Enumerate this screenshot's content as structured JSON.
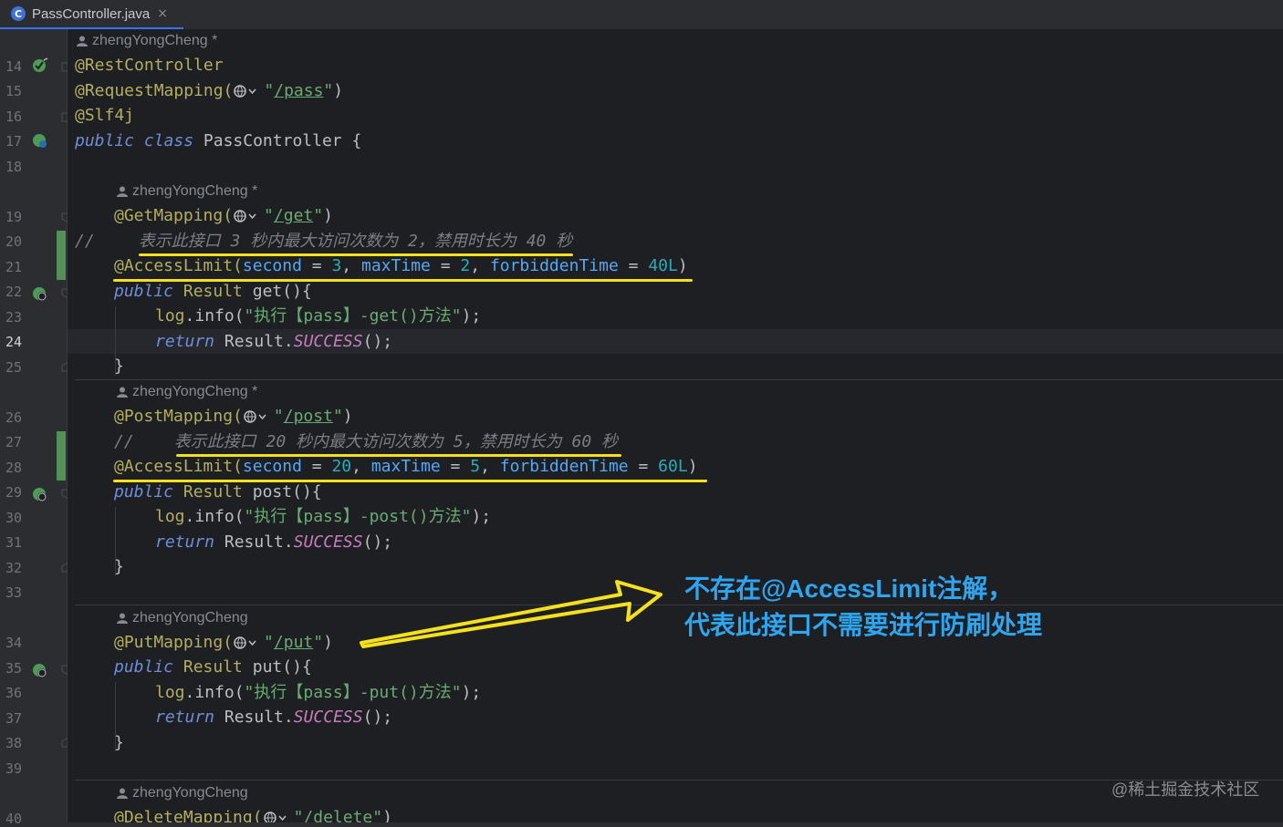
{
  "tab": {
    "label": "PassController.java",
    "icon": "java-class-icon",
    "close": "×"
  },
  "authors": {
    "a1": "zhengYongCheng *",
    "a2": "zhengYongCheng *",
    "a3": "zhengYongCheng *",
    "a4": "zhengYongCheng",
    "a5": "zhengYongCheng"
  },
  "lines": {
    "l14": "14",
    "l15": "15",
    "l16": "16",
    "l17": "17",
    "l18": "18",
    "l19": "19",
    "l20": "20",
    "l21": "21",
    "l22": "22",
    "l23": "23",
    "l24": "24",
    "l25": "25",
    "l26": "26",
    "l27": "27",
    "l28": "28",
    "l29": "29",
    "l30": "30",
    "l31": "31",
    "l32": "32",
    "l33": "33",
    "l34": "34",
    "l35": "35",
    "l36": "36",
    "l37": "37",
    "l38": "38",
    "l39": "39",
    "l40": "40"
  },
  "code": {
    "rest": "@RestController",
    "reqmap": "@RequestMapping(",
    "reqmap_url": "/pass",
    "slf": "@Slf4j",
    "cls_public": "public",
    "cls_class": "class",
    "cls_name": "PassController {",
    "get_map": "@GetMapping(",
    "get_url": "/get",
    "get_comment_slashes": "//",
    "get_comment": "表示此接口 3 秒内最大访问次数为 2，禁用时长为 40 秒",
    "get_al": "@AccessLimit(",
    "second_kw": "second",
    "eq": "=",
    "get_second": "3",
    "maxtime_kw": "maxTime",
    "get_maxtime": "2",
    "ft_kw": "forbiddenTime",
    "get_ft": "40L",
    "public": "public",
    "result": "Result",
    "get_fn": "get",
    "get_log": "\"执行【pass】-get()方法\"",
    "log": "log",
    "info": ".info(",
    "return": "return",
    "success": "SUCCESS",
    "post_map": "@PostMapping(",
    "post_url": "/post",
    "post_comment": "表示此接口 20 秒内最大访问次数为 5，禁用时长为 60 秒",
    "post_second": "20",
    "post_maxtime": "5",
    "post_ft": "60L",
    "post_fn": "post",
    "post_log": "\"执行【pass】-post()方法\"",
    "put_map": "@PutMapping(",
    "put_url": "/put",
    "put_fn": "put",
    "put_log": "\"执行【pass】-put()方法\"",
    "delete_map": "@DeleteMapping(",
    "delete_url": "/delete"
  },
  "annotation_note": {
    "line1": "不存在@AccessLimit注解，",
    "line2": "代表此接口不需要进行防刷处理"
  },
  "watermark": "@稀土掘金技术社区",
  "colors": {
    "highlight": "#f4e01e",
    "note": "#2fa5f0",
    "editor_bg": "#1e1f22",
    "annotation": "#b3ae60",
    "keyword": "#6e8ed9"
  }
}
